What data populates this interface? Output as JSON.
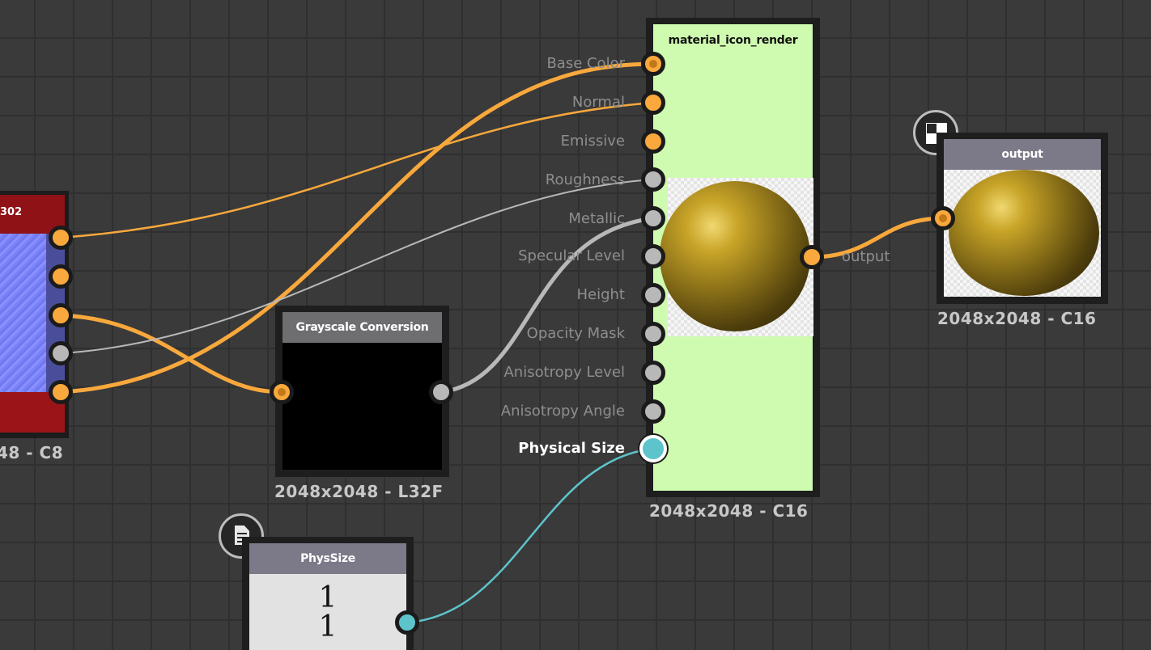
{
  "nodes": {
    "left_node": {
      "title_fragment": "302",
      "resolution_fragment": "48 - C8"
    },
    "grayscale": {
      "title": "Grayscale Conversion",
      "resolution": "2048x2048 - L32F"
    },
    "material": {
      "title": "material_icon_render",
      "resolution": "2048x2048 - C16",
      "output_label": "output",
      "inputs": [
        {
          "label": "Base Color",
          "type": "color"
        },
        {
          "label": "Normal",
          "type": "color"
        },
        {
          "label": "Emissive",
          "type": "color"
        },
        {
          "label": "Roughness",
          "type": "grayscale"
        },
        {
          "label": "Metallic",
          "type": "grayscale"
        },
        {
          "label": "Specular Level",
          "type": "grayscale"
        },
        {
          "label": "Height",
          "type": "grayscale"
        },
        {
          "label": "Opacity Mask",
          "type": "grayscale"
        },
        {
          "label": "Anisotropy Level",
          "type": "grayscale"
        },
        {
          "label": "Anisotropy Angle",
          "type": "grayscale"
        },
        {
          "label": "Physical Size",
          "type": "value"
        }
      ]
    },
    "output": {
      "title": "output",
      "resolution": "2048x2048 - C16",
      "badge_icon": "checker-icon"
    },
    "physsize": {
      "title": "PhysSize",
      "value_line1": "1",
      "value_line2": "1",
      "badge_icon": "document-icon"
    }
  },
  "colors": {
    "graph_background": "#3a3a3a",
    "color_wire": "#f8a83c",
    "grayscale_wire": "#b8b8b8",
    "value_wire": "#5ec4cc",
    "material_body": "#cffbb0",
    "left_node_header": "#8e1216",
    "title_bar": "#7c7a88"
  }
}
